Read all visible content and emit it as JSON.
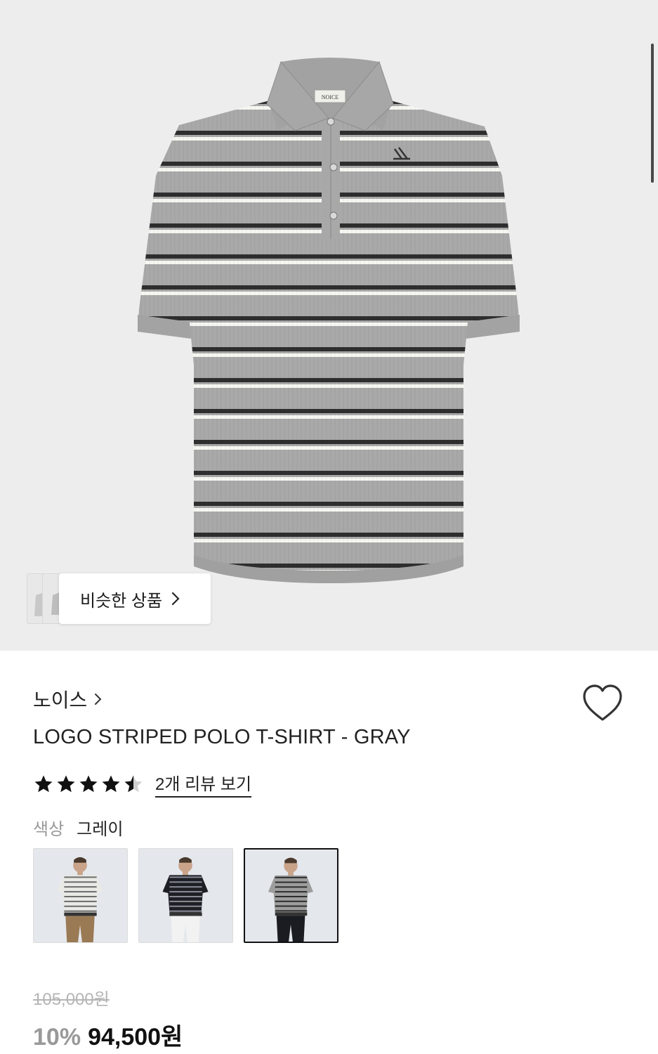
{
  "product": {
    "brand": "노이스",
    "title": "LOGO STRIPED POLO T-SHIRT - GRAY",
    "label_text": "NOICE",
    "rating": 4.5,
    "review_link": "2개 리뷰 보기",
    "color_label": "색상",
    "color_value": "그레이",
    "original_price": "105,000원",
    "discount": "10%",
    "price": "94,500원"
  },
  "similar": {
    "label": "비슷한 상품"
  },
  "variants": [
    {
      "name": "white-stripe-variant",
      "shirt_color": "#e9e9e6",
      "stripe_color": "#6a6a6a",
      "pants_color": "#9a7a55",
      "selected": false
    },
    {
      "name": "black-stripe-variant",
      "shirt_color": "#1d1f24",
      "stripe_color": "#8a8e99",
      "pants_color": "#f2f2f2",
      "selected": false
    },
    {
      "name": "gray-stripe-variant",
      "shirt_color": "#9d9d9d",
      "stripe_color": "#2a2a2a",
      "pants_color": "#1a1c22",
      "selected": true
    }
  ],
  "icons": {
    "heart": "heart-icon",
    "chevron": "chevron-right-icon",
    "star": "star-icon"
  },
  "colors": {
    "hero_bg": "#ededed",
    "shirt_gray": "#a8a8a8",
    "stripe_dark": "#2e2e2e",
    "stripe_light": "#f7f7f2"
  }
}
